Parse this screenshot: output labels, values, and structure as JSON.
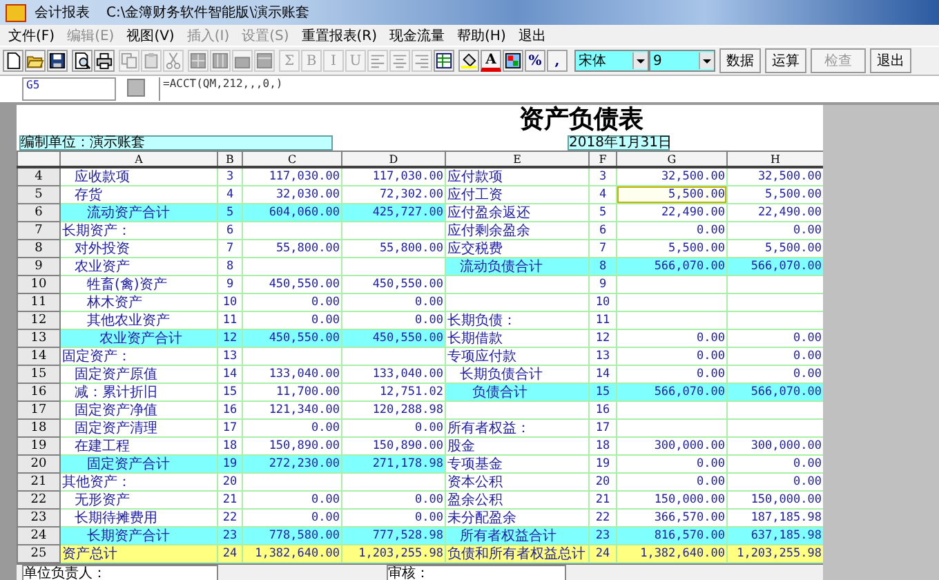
{
  "window": {
    "title": "会计报表",
    "path": "C:\\金簿财务软件智能版\\演示账套"
  },
  "menu": [
    {
      "label": "文件(F)",
      "disabled": false
    },
    {
      "label": "编辑(E)",
      "disabled": true
    },
    {
      "label": "视图(V)",
      "disabled": false
    },
    {
      "label": "插入(I)",
      "disabled": true
    },
    {
      "label": "设置(S)",
      "disabled": true
    },
    {
      "label": "重置报表(R)",
      "disabled": false
    },
    {
      "label": "现金流量",
      "disabled": false
    },
    {
      "label": "帮助(H)",
      "disabled": false
    },
    {
      "label": "退出",
      "disabled": false
    }
  ],
  "toolbar": {
    "groups": [
      [
        {
          "kind": "icon",
          "disabled": false
        },
        {
          "kind": "icon",
          "disabled": false
        },
        {
          "kind": "icon",
          "disabled": false
        }
      ],
      [
        {
          "kind": "icon",
          "disabled": false
        },
        {
          "kind": "icon",
          "disabled": false
        }
      ],
      [
        {
          "kind": "icon",
          "disabled": true
        },
        {
          "kind": "icon",
          "disabled": true
        },
        {
          "kind": "icon",
          "disabled": true
        }
      ],
      [
        {
          "kind": "icon",
          "disabled": true
        },
        {
          "kind": "icon",
          "disabled": true
        },
        {
          "kind": "icon",
          "disabled": true
        },
        {
          "kind": "icon",
          "disabled": true
        }
      ],
      [
        {
          "kind": "glyph",
          "label": "Σ",
          "disabled": true
        },
        {
          "kind": "glyph",
          "label": "B",
          "disabled": true
        },
        {
          "kind": "glyph",
          "label": "I",
          "disabled": true
        },
        {
          "kind": "glyph",
          "label": "U",
          "disabled": true
        },
        {
          "kind": "icon",
          "disabled": true
        },
        {
          "kind": "icon",
          "disabled": true
        },
        {
          "kind": "icon",
          "disabled": true
        },
        {
          "kind": "icon",
          "disabled": false
        }
      ],
      [
        {
          "kind": "icon",
          "disabled": false
        },
        {
          "kind": "color_glyph",
          "label": "A",
          "disabled": false
        },
        {
          "kind": "icon",
          "disabled": false
        },
        {
          "kind": "glyph",
          "label": "%",
          "disabled": false
        },
        {
          "kind": "glyph",
          "label": ",",
          "disabled": false
        }
      ]
    ],
    "font": "宋体",
    "size": "9",
    "buttons": [
      {
        "label": "数据",
        "disabled": false
      },
      {
        "label": "运算",
        "disabled": false
      },
      {
        "label": "检查",
        "disabled": true
      },
      {
        "label": "退出",
        "disabled": false
      }
    ]
  },
  "formula_bar": {
    "cell": "G5",
    "formula": "=ACCT(QM,212,,,0,)"
  },
  "report": {
    "title": "资产负债表",
    "unit": "编制单位：演示账套",
    "date": "2018年1月31日",
    "columns": [
      "A",
      "B",
      "C",
      "D",
      "E",
      "F",
      "G",
      "H"
    ],
    "rows": [
      {
        "n": "4",
        "left": {
          "kind": "item",
          "selected": false,
          "a": "应收款项",
          "b": "3",
          "c": "117,030.00",
          "d": "117,030.00"
        },
        "right": {
          "kind": "line",
          "selected": false,
          "e": "应付款项",
          "f": "3",
          "g": "32,500.00",
          "h": "32,500.00"
        }
      },
      {
        "n": "5",
        "left": {
          "kind": "item",
          "selected": false,
          "a": "存货",
          "b": "4",
          "c": "32,030.00",
          "d": "72,302.00"
        },
        "right": {
          "kind": "line",
          "selected": true,
          "e": "应付工资",
          "f": "4",
          "g": "5,500.00",
          "h": "5,500.00"
        }
      },
      {
        "n": "6",
        "left": {
          "kind": "subtotal",
          "selected": false,
          "a": "流动资产合计",
          "b": "5",
          "c": "604,060.00",
          "d": "425,727.00"
        },
        "right": {
          "kind": "line",
          "selected": false,
          "e": "应付盈余返还",
          "f": "5",
          "g": "22,490.00",
          "h": "22,490.00"
        }
      },
      {
        "n": "7",
        "left": {
          "kind": "line",
          "selected": false,
          "a": "长期资产：",
          "b": "6"
        },
        "right": {
          "kind": "line",
          "selected": false,
          "e": "应付剩余盈余",
          "f": "6",
          "g": "0.00",
          "h": "0.00"
        }
      },
      {
        "n": "8",
        "left": {
          "kind": "item",
          "selected": false,
          "a": "对外投资",
          "b": "7",
          "c": "55,800.00",
          "d": "55,800.00"
        },
        "right": {
          "kind": "line",
          "selected": false,
          "e": "应交税费",
          "f": "7",
          "g": "5,500.00",
          "h": "5,500.00"
        }
      },
      {
        "n": "9",
        "left": {
          "kind": "item",
          "selected": false,
          "a": "农业资产",
          "b": "8"
        },
        "right": {
          "kind": "sum",
          "selected": false,
          "e": "流动负债合计",
          "f": "8",
          "g": "566,070.00",
          "h": "566,070.00"
        }
      },
      {
        "n": "10",
        "left": {
          "kind": "subitem",
          "selected": false,
          "a": "牲畜(禽)资产",
          "b": "9",
          "c": "450,550.00",
          "d": "450,550.00"
        },
        "right": {
          "kind": "line",
          "selected": false,
          "f": "9"
        }
      },
      {
        "n": "11",
        "left": {
          "kind": "subitem",
          "selected": false,
          "a": "林木资产",
          "b": "10",
          "c": "0.00",
          "d": "0.00"
        },
        "right": {
          "kind": "line",
          "selected": false,
          "f": "10"
        }
      },
      {
        "n": "12",
        "left": {
          "kind": "subitem",
          "selected": false,
          "a": "其他农业资产",
          "b": "11",
          "c": "0.00",
          "d": "0.00"
        },
        "right": {
          "kind": "line",
          "selected": false,
          "e": "长期负债：",
          "f": "11"
        }
      },
      {
        "n": "13",
        "left": {
          "kind": "group_total",
          "selected": false,
          "a": "农业资产合计",
          "b": "12",
          "c": "450,550.00",
          "d": "450,550.00"
        },
        "right": {
          "kind": "line",
          "selected": false,
          "e": "长期借款",
          "f": "12",
          "g": "0.00",
          "h": "0.00"
        }
      },
      {
        "n": "14",
        "left": {
          "kind": "line",
          "selected": false,
          "a": "固定资产：",
          "b": "13"
        },
        "right": {
          "kind": "line",
          "selected": false,
          "e": "专项应付款",
          "f": "13",
          "g": "0.00",
          "h": "0.00"
        }
      },
      {
        "n": "15",
        "left": {
          "kind": "item",
          "selected": false,
          "a": "固定资产原值",
          "b": "14",
          "c": "133,040.00",
          "d": "133,040.00"
        },
        "right": {
          "kind": "item",
          "selected": false,
          "e": "长期负债合计",
          "f": "14",
          "g": "0.00",
          "h": "0.00"
        }
      },
      {
        "n": "16",
        "left": {
          "kind": "item",
          "selected": false,
          "a": "减：累计折旧",
          "b": "15",
          "c": "11,700.00",
          "d": "12,751.02"
        },
        "right": {
          "kind": "subtotal",
          "selected": false,
          "e": "负债合计",
          "f": "15",
          "g": "566,070.00",
          "h": "566,070.00"
        }
      },
      {
        "n": "17",
        "left": {
          "kind": "item",
          "selected": false,
          "a": "固定资产净值",
          "b": "16",
          "c": "121,340.00",
          "d": "120,288.98"
        },
        "right": {
          "kind": "line",
          "selected": false,
          "f": "16"
        }
      },
      {
        "n": "18",
        "left": {
          "kind": "item",
          "selected": false,
          "a": "固定资产清理",
          "b": "17",
          "c": "0.00",
          "d": "0.00"
        },
        "right": {
          "kind": "line",
          "selected": false,
          "e": "所有者权益：",
          "f": "17"
        }
      },
      {
        "n": "19",
        "left": {
          "kind": "item",
          "selected": false,
          "a": "在建工程",
          "b": "18",
          "c": "150,890.00",
          "d": "150,890.00"
        },
        "right": {
          "kind": "line",
          "selected": false,
          "e": "股金",
          "f": "18",
          "g": "300,000.00",
          "h": "300,000.00"
        }
      },
      {
        "n": "20",
        "left": {
          "kind": "subtotal",
          "selected": false,
          "a": "固定资产合计",
          "b": "19",
          "c": "272,230.00",
          "d": "271,178.98"
        },
        "right": {
          "kind": "line",
          "selected": false,
          "e": "专项基金",
          "f": "19",
          "g": "0.00",
          "h": "0.00"
        }
      },
      {
        "n": "21",
        "left": {
          "kind": "line",
          "selected": false,
          "a": "其他资产：",
          "b": "20"
        },
        "right": {
          "kind": "line",
          "selected": false,
          "e": "资本公积",
          "f": "20",
          "g": "0.00",
          "h": "0.00"
        }
      },
      {
        "n": "22",
        "left": {
          "kind": "item",
          "selected": false,
          "a": "无形资产",
          "b": "21",
          "c": "0.00",
          "d": "0.00"
        },
        "right": {
          "kind": "line",
          "selected": false,
          "e": "盈余公积",
          "f": "21",
          "g": "150,000.00",
          "h": "150,000.00"
        }
      },
      {
        "n": "23",
        "left": {
          "kind": "item",
          "selected": false,
          "a": "长期待摊费用",
          "b": "22",
          "c": "0.00",
          "d": "0.00"
        },
        "right": {
          "kind": "line",
          "selected": false,
          "e": "未分配盈余",
          "f": "22",
          "g": "366,570.00",
          "h": "187,185.98"
        }
      },
      {
        "n": "24",
        "left": {
          "kind": "subtotal",
          "selected": false,
          "a": "长期资产合计",
          "b": "23",
          "c": "778,580.00",
          "d": "777,528.98"
        },
        "right": {
          "kind": "sum",
          "selected": false,
          "e": "所有者权益合计",
          "f": "23",
          "g": "816,570.00",
          "h": "637,185.98"
        }
      },
      {
        "n": "25",
        "left": {
          "kind": "grand_total",
          "selected": false,
          "a": "资产总计",
          "b": "24",
          "c": "1,382,640.00",
          "d": "1,203,255.98"
        },
        "right": {
          "kind": "grand_total",
          "selected": false,
          "e": "负债和所有者权益总计",
          "f": "24",
          "g": "1,382,640.00",
          "h": "1,203,255.98"
        }
      }
    ],
    "footer": [
      "单位负责人：",
      "审核："
    ]
  }
}
